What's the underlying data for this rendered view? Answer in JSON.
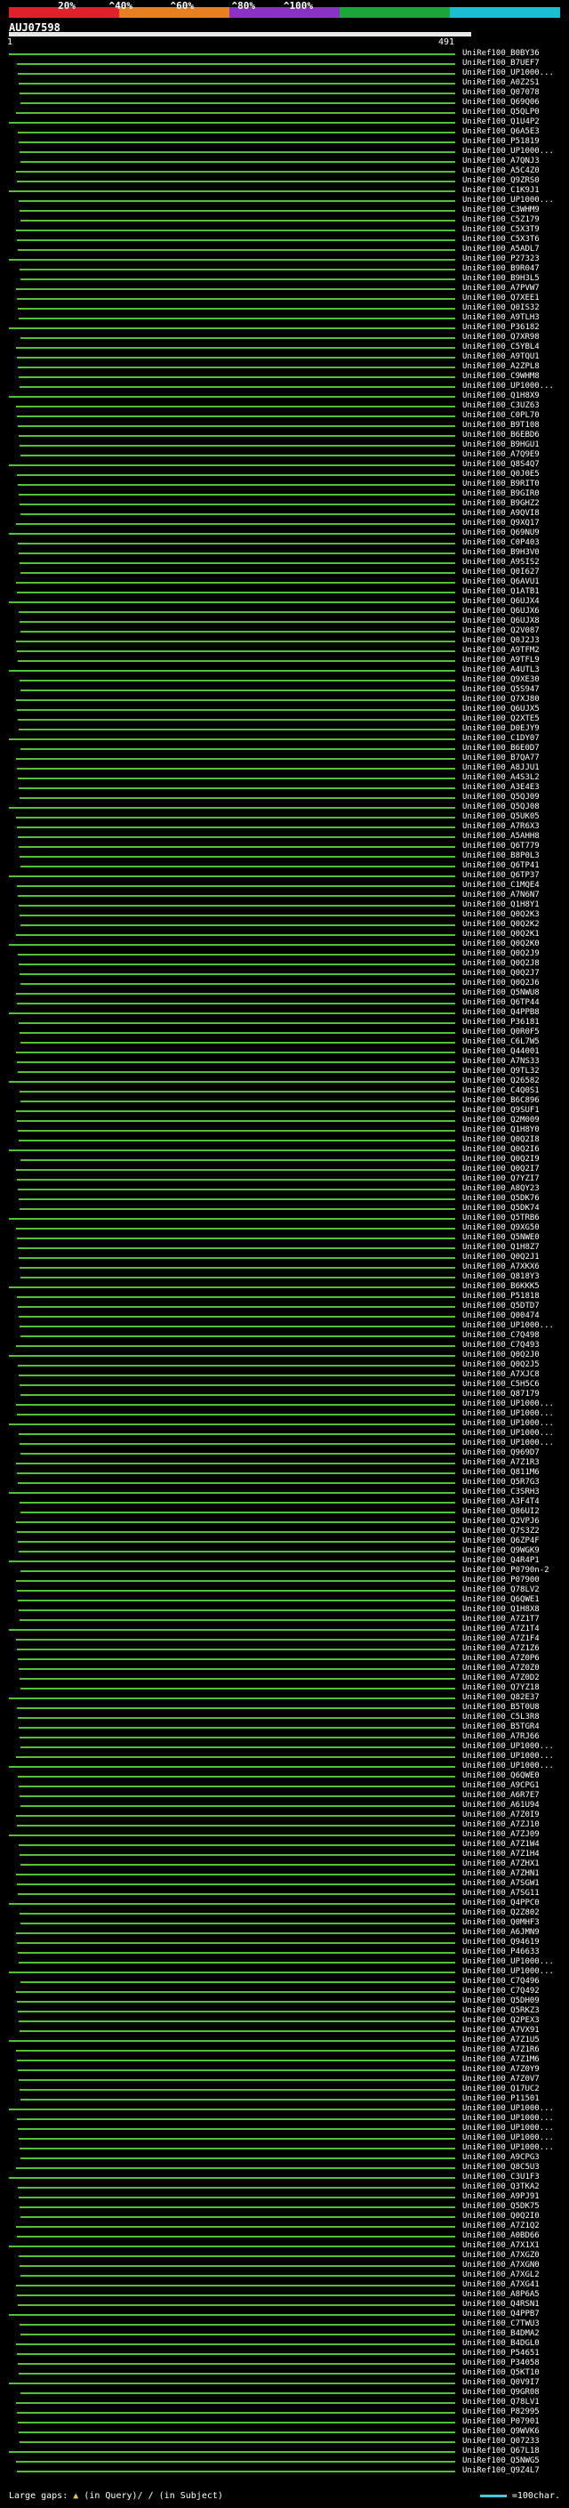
{
  "palette": [
    "#e0202b",
    "#e87f20",
    "#8a32c6",
    "#1aa63a",
    "#1abfd2"
  ],
  "pct_labels": [
    "20%",
    "^40%",
    "^60%",
    "^80%",
    "^100%"
  ],
  "query": {
    "name": "AUJ07598",
    "start": "1",
    "end": "491"
  },
  "hits": [
    "UniRef100_B0BY36",
    "UniRef100_B7UEF7",
    "UniRef100_UP1000...",
    "UniRef100_A0Z2S1",
    "UniRef100_Q07078",
    "UniRef100_Q69Q06",
    "UniRef100_Q5QLP0",
    "UniRef100_Q1U4P2",
    "UniRef100_Q6A5E3",
    "UniRef100_P51819",
    "UniRef100_UP1000...",
    "UniRef100_A7QNJ3",
    "UniRef100_A5C4Z0",
    "UniRef100_Q9ZRS0",
    "UniRef100_C1K9J1",
    "UniRef100_UP1000...",
    "UniRef100_C3WHM9",
    "UniRef100_C5Z179",
    "UniRef100_C5X3T9",
    "UniRef100_C5X3T6",
    "UniRef100_A5ADL7",
    "UniRef100_P27323",
    "UniRef100_B9R047",
    "UniRef100_B9H3L5",
    "UniRef100_A7PVW7",
    "UniRef100_Q7XEE1",
    "UniRef100_Q0IS32",
    "UniRef100_A9TLH3",
    "UniRef100_P36182",
    "UniRef100_Q7XR98",
    "UniRef100_C5YBL4",
    "UniRef100_A9TQU1",
    "UniRef100_A2ZPL8",
    "UniRef100_C9WHM8",
    "UniRef100_UP1000...",
    "UniRef100_Q1H8X9",
    "UniRef100_C3UZ63",
    "UniRef100_C0PL70",
    "UniRef100_B9T108",
    "UniRef100_B6EBD6",
    "UniRef100_B9HGU1",
    "UniRef100_A7Q9E9",
    "UniRef100_Q8S4Q7",
    "UniRef100_Q0J0E5",
    "UniRef100_B9RIT0",
    "UniRef100_B9GIR0",
    "UniRef100_B9GHZ2",
    "UniRef100_A9QVI8",
    "UniRef100_Q9XQ17",
    "UniRef100_Q69NU9",
    "UniRef100_C0P403",
    "UniRef100_B9H3V0",
    "UniRef100_A9SIS2",
    "UniRef100_Q0I627",
    "UniRef100_Q6AVU1",
    "UniRef100_Q1ATB1",
    "UniRef100_Q6UJX4",
    "UniRef100_Q6UJX6",
    "UniRef100_Q6UJX8",
    "UniRef100_Q2V087",
    "UniRef100_Q0J2J3",
    "UniRef100_A9TFM2",
    "UniRef100_A9TFL9",
    "UniRef100_A4UTL3",
    "UniRef100_Q9XE30",
    "UniRef100_Q5S947",
    "UniRef100_Q7XJ80",
    "UniRef100_Q6UJX5",
    "UniRef100_Q2XTE5",
    "UniRef100_D0EJY9",
    "UniRef100_C1DY07",
    "UniRef100_B6E0D7",
    "UniRef100_B7QA77",
    "UniRef100_A8JJU1",
    "UniRef100_A4S3L2",
    "UniRef100_A3E4E3",
    "UniRef100_Q5QJ09",
    "UniRef100_Q5QJ08",
    "UniRef100_Q5UK05",
    "UniRef100_A7R6X3",
    "UniRef100_A5AHH8",
    "UniRef100_Q6T779",
    "UniRef100_B8P0L3",
    "UniRef100_Q6TP41",
    "UniRef100_Q6TP37",
    "UniRef100_C1MQE4",
    "UniRef100_A7N6N7",
    "UniRef100_Q1H8Y1",
    "UniRef100_Q0Q2K3",
    "UniRef100_Q0Q2K2",
    "UniRef100_Q0Q2K1",
    "UniRef100_Q0Q2K0",
    "UniRef100_Q0Q2J9",
    "UniRef100_Q0Q2J8",
    "UniRef100_Q0Q2J7",
    "UniRef100_Q0Q2J6",
    "UniRef100_Q5NWU8",
    "UniRef100_Q6TP44",
    "UniRef100_Q4PPB8",
    "UniRef100_P36181",
    "UniRef100_Q0R0F5",
    "UniRef100_C6L7W5",
    "UniRef100_Q44001",
    "UniRef100_A7NS33",
    "UniRef100_Q9TL32",
    "UniRef100_Q26582",
    "UniRef100_C4Q0S1",
    "UniRef100_B6C896",
    "UniRef100_Q9SUF1",
    "UniRef100_Q2M009",
    "UniRef100_Q1H8Y0",
    "UniRef100_Q0Q2I8",
    "UniRef100_Q0Q2I6",
    "UniRef100_Q0Q2I9",
    "UniRef100_Q0Q2I7",
    "UniRef100_Q7YZI7",
    "UniRef100_A8QY23",
    "UniRef100_Q5DK76",
    "UniRef100_Q5DK74",
    "UniRef100_Q5TRB6",
    "UniRef100_Q9XG50",
    "UniRef100_Q5NWE0",
    "UniRef100_Q1H8Z7",
    "UniRef100_Q0Q2J1",
    "UniRef100_A7XKX6",
    "UniRef100_Q818Y3",
    "UniRef100_B6KKK5",
    "UniRef100_P51818",
    "UniRef100_Q5DTD7",
    "UniRef100_Q00474",
    "UniRef100_UP1000...",
    "UniRef100_C7Q498",
    "UniRef100_C7Q493",
    "UniRef100_Q0Q2J0",
    "UniRef100_Q0Q2J5",
    "UniRef100_A7XJC8",
    "UniRef100_C5H5C6",
    "UniRef100_Q87179",
    "UniRef100_UP1000...",
    "UniRef100_UP1000...",
    "UniRef100_UP1000...",
    "UniRef100_UP1000...",
    "UniRef100_UP1000...",
    "UniRef100_Q969D7",
    "UniRef100_A7Z1R3",
    "UniRef100_Q811M6",
    "UniRef100_Q5R7G3",
    "UniRef100_C3SRH3",
    "UniRef100_A3F4T4",
    "UniRef100_Q86UI2",
    "UniRef100_Q2VPJ6",
    "UniRef100_Q7S3Z2",
    "UniRef100_Q6ZP4F",
    "UniRef100_Q9WGK9",
    "UniRef100_Q4R4P1",
    "UniRef100_P0790n-2",
    "UniRef100_P07900",
    "UniRef100_Q78LV2",
    "UniRef100_Q6QWE1",
    "UniRef100_Q1H8X8",
    "UniRef100_A7Z1T7",
    "UniRef100_A7Z1T4",
    "UniRef100_A7Z1F4",
    "UniRef100_A7Z1Z6",
    "UniRef100_A7Z0P6",
    "UniRef100_A7Z0Z0",
    "UniRef100_A7Z0D2",
    "UniRef100_Q7YZ18",
    "UniRef100_Q82E37",
    "UniRef100_B5T0U8",
    "UniRef100_C5L3R8",
    "UniRef100_B5TGR4",
    "UniRef100_A7RJ66",
    "UniRef100_UP1000...",
    "UniRef100_UP1000...",
    "UniRef100_UP1000...",
    "UniRef100_Q6QWE0",
    "UniRef100_A9CPG1",
    "UniRef100_A6R7E7",
    "UniRef100_A61U94",
    "UniRef100_A7Z0I9",
    "UniRef100_A7ZJ10",
    "UniRef100_A7ZJ09",
    "UniRef100_A7Z1W4",
    "UniRef100_A7Z1H4",
    "UniRef100_A7ZHX1",
    "UniRef100_A7ZHN1",
    "UniRef100_A7SGW1",
    "UniRef100_A7SG11",
    "UniRef100_Q4PPC0",
    "UniRef100_Q2Z802",
    "UniRef100_Q0MHF3",
    "UniRef100_A6JMN9",
    "UniRef100_Q94619",
    "UniRef100_P46633",
    "UniRef100_UP1000...",
    "UniRef100_UP1000...",
    "UniRef100_C7Q496",
    "UniRef100_C7Q492",
    "UniRef100_Q5DH09",
    "UniRef100_Q5RKZ3",
    "UniRef100_Q2PEX3",
    "UniRef100_A7VX91",
    "UniRef100_A7Z1U5",
    "UniRef100_A7Z1R6",
    "UniRef100_A7Z1M6",
    "UniRef100_A7Z0Y9",
    "UniRef100_A7Z0V7",
    "UniRef100_Q17UC2",
    "UniRef100_P11501",
    "UniRef100_UP1000...",
    "UniRef100_UP1000...",
    "UniRef100_UP1000...",
    "UniRef100_UP1000...",
    "UniRef100_UP1000...",
    "UniRef100_A9CPG3",
    "UniRef100_Q8C5U3",
    "UniRef100_C3U1F3",
    "UniRef100_Q3TKA2",
    "UniRef100_A9PJ91",
    "UniRef100_Q5DK75",
    "UniRef100_Q0Q2I0",
    "UniRef100_A7Z1Q2",
    "UniRef100_A0BD66",
    "UniRef100_A7X1X1",
    "UniRef100_A7XGZ0",
    "UniRef100_A7XGN0",
    "UniRef100_A7XGL2",
    "UniRef100_A7XG41",
    "UniRef100_A8P6A5",
    "UniRef100_Q4RSN1",
    "UniRef100_Q4PPB7",
    "UniRef100_C7TWU3",
    "UniRef100_B4DMA2",
    "UniRef100_B4DGL0",
    "UniRef100_P54651",
    "UniRef100_P34058",
    "UniRef100_Q5KT10",
    "UniRef100_Q0V9I7",
    "UniRef100_Q9GR08",
    "UniRef100_Q78LV1",
    "UniRef100_P82995",
    "UniRef100_P07901",
    "UniRef100_Q9WVK6",
    "UniRef100_Q07233",
    "UniRef100_Q67L18",
    "UniRef100_Q5NWG5",
    "UniRef100_Q9Z4L7"
  ],
  "footer": {
    "large_gaps_label": "Large gaps:",
    "in_query": "(in Query)/",
    "in_subject": "(in Subject)",
    "scale_label": "=100char."
  }
}
